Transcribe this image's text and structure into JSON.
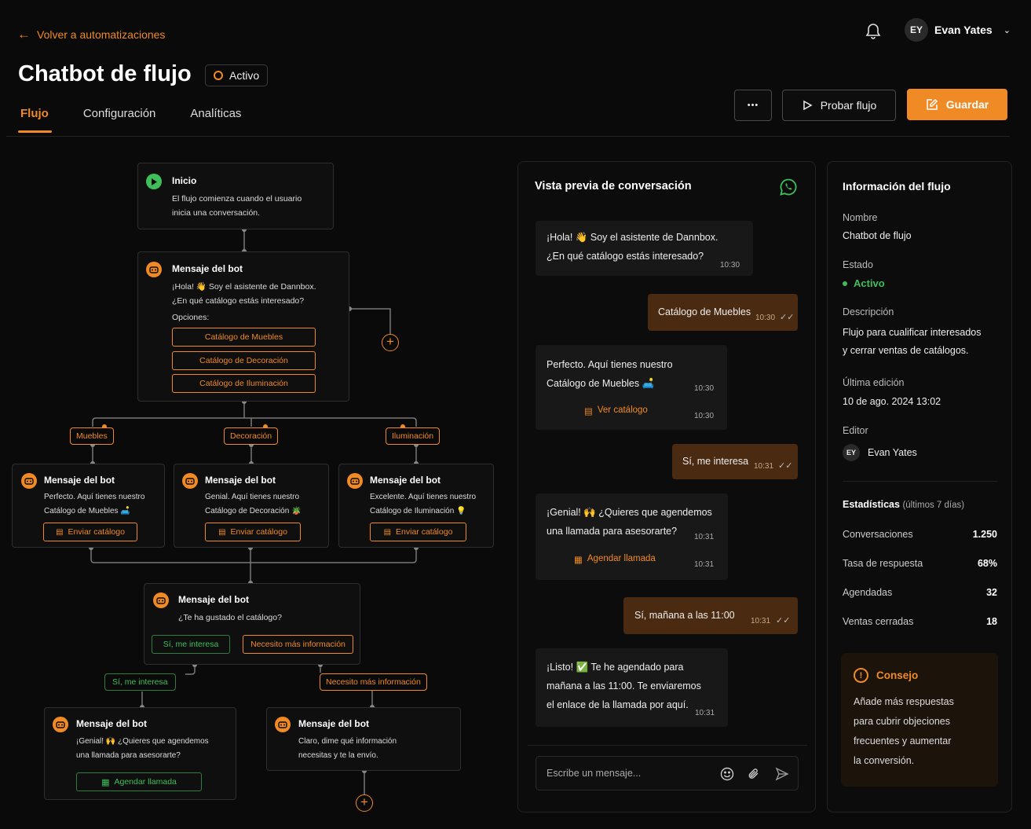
{
  "header": {
    "back_label": "Volver a automatizaciones",
    "title": "Chatbot de flujo",
    "status": "Activo",
    "user_initials": "EY",
    "user_name": "Evan Yates"
  },
  "tabs": [
    {
      "label": "Flujo",
      "active": true
    },
    {
      "label": "Configuración",
      "active": false
    },
    {
      "label": "Analíticas",
      "active": false
    }
  ],
  "actions": {
    "more": "•••",
    "test": "Probar flujo",
    "save": "Guardar"
  },
  "flow": {
    "start": {
      "title": "Inicio",
      "line1": "El flujo comienza cuando el usuario",
      "line2": "inicia una conversación."
    },
    "bot1": {
      "title": "Mensaje del bot",
      "line1": "¡Hola! 👋 Soy el asistente de Dannbox.",
      "line2": "¿En qué catálogo estás interesado?",
      "options_label": "Opciones:",
      "options": [
        "Catálogo de Muebles",
        "Catálogo de Decoración",
        "Catálogo de Iluminación"
      ]
    },
    "branches": [
      "Muebles",
      "Decoración",
      "Iluminación"
    ],
    "bot_muebles": {
      "title": "Mensaje del bot",
      "line1": "Perfecto. Aquí tienes nuestro",
      "line2": "Catálogo de Muebles 🛋️",
      "button": "Enviar catálogo"
    },
    "bot_decoracion": {
      "title": "Mensaje del bot",
      "line1": "Genial. Aquí tienes nuestro",
      "line2": "Catálogo de Decoración 🪴",
      "button": "Enviar catálogo"
    },
    "bot_iluminacion": {
      "title": "Mensaje del bot",
      "line1": "Excelente. Aquí tienes nuestro",
      "line2": "Catálogo de Iluminación 💡",
      "button": "Enviar catálogo"
    },
    "bot_question": {
      "title": "Mensaje del bot",
      "line1": "¿Te ha gustado el catálogo?",
      "yes": "Sí, me interesa",
      "more": "Necesito más información"
    },
    "tag_yes": "Sí, me interesa",
    "tag_more": "Necesito más información",
    "bot_schedule": {
      "title": "Mensaje del bot",
      "line1": "¡Genial! 🙌 ¿Quieres que agendemos",
      "line2": "una llamada para asesorarte?",
      "button": "Agendar llamada"
    },
    "bot_info": {
      "title": "Mensaje del bot",
      "line1": "Claro, dime qué información",
      "line2": "necesitas y te la envío."
    }
  },
  "chat": {
    "title": "Vista previa de conversación",
    "m1_l1": "¡Hola! 👋 Soy el asistente de Dannbox.",
    "m1_l2": "¿En qué catálogo estás interesado?",
    "m1_time": "10:30",
    "m2": "Catálogo de Muebles",
    "m2_time": "10:30",
    "m3_l1": "Perfecto. Aquí tienes nuestro",
    "m3_l2": "Catálogo de Muebles 🛋️",
    "m3_time": "10:30",
    "m3_link": "Ver catálogo",
    "m3_link_time": "10:30",
    "m4": "Sí, me interesa",
    "m4_time": "10:31",
    "m5_l1": "¡Genial! 🙌 ¿Quieres que agendemos",
    "m5_l2": "una llamada para asesorarte?",
    "m5_time": "10:31",
    "m5_link": "Agendar llamada",
    "m5_link_time": "10:31",
    "m6": "Sí, mañana a las 11:00",
    "m6_time": "10:31",
    "m7_l1": "¡Listo! ✅ Te he agendado para",
    "m7_l2": "mañana a las 11:00. Te enviaremos",
    "m7_l3": "el enlace de la llamada por aquí.",
    "m7_time": "10:31",
    "input_placeholder": "Escribe un mensaje..."
  },
  "info": {
    "title": "Información del flujo",
    "name_label": "Nombre",
    "name": "Chatbot de flujo",
    "state_label": "Estado",
    "state": "Activo",
    "desc_label": "Descripción",
    "desc_l1": "Flujo para cualificar interesados",
    "desc_l2": "y cerrar ventas de catálogos.",
    "edited_label": "Última edición",
    "edited": "10 de ago. 2024 13:02",
    "editor_label": "Editor",
    "editor_initials": "EY",
    "editor": "Evan Yates",
    "stats_label": "Estadísticas",
    "stats_period": "(últimos 7 días)",
    "stats": [
      {
        "label": "Conversaciones",
        "value": "1.250"
      },
      {
        "label": "Tasa de respuesta",
        "value": "68%"
      },
      {
        "label": "Agendadas",
        "value": "32"
      },
      {
        "label": "Ventas cerradas",
        "value": "18"
      }
    ],
    "tip_title": "Consejo",
    "tip_l1": "Añade más respuestas",
    "tip_l2": "para cubrir objeciones",
    "tip_l3": "frecuentes y aumentar",
    "tip_l4": "la conversión."
  },
  "colors": {
    "accent": "#f08a24",
    "success": "#3fbf5a",
    "background": "#0a0a0a"
  }
}
